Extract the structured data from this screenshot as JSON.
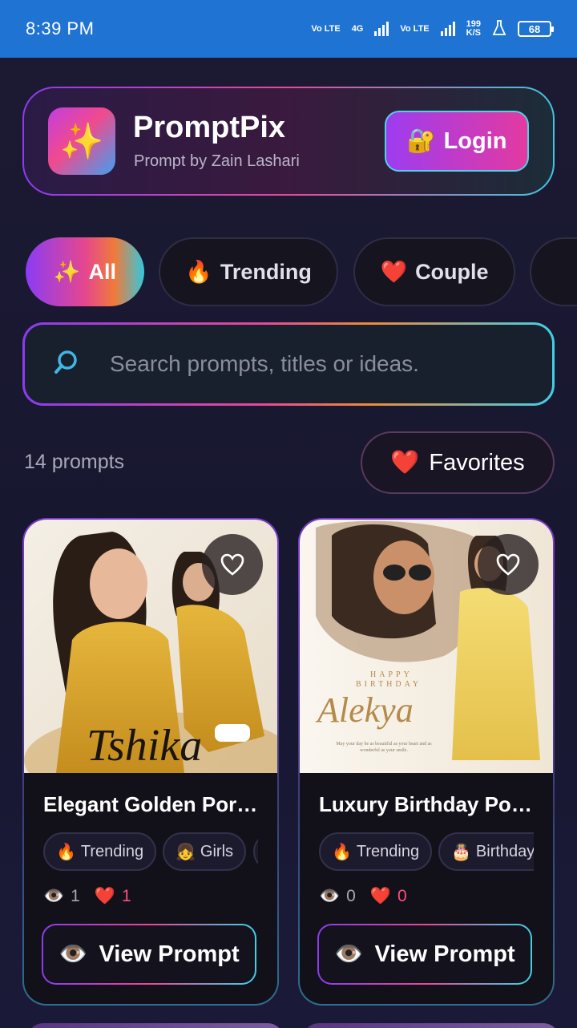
{
  "status_bar": {
    "time": "8:39 PM",
    "volte1": "Vo LTE",
    "network": "4G",
    "volte2": "Vo LTE",
    "speed_value": "199",
    "speed_unit": "K/S",
    "battery": "68"
  },
  "header": {
    "logo_icon": "sparkles-icon",
    "title": "PromptPix",
    "subtitle": "Prompt by Zain Lashari",
    "login_label": "Login",
    "login_icon": "lock-key-icon"
  },
  "categories": [
    {
      "icon": "✨",
      "label": "All",
      "active": true
    },
    {
      "icon": "🔥",
      "label": "Trending",
      "active": false
    },
    {
      "icon": "❤️",
      "label": "Couple",
      "active": false
    }
  ],
  "search": {
    "placeholder": "Search prompts, titles or ideas."
  },
  "summary": {
    "count_label": "14 prompts",
    "favorites_label": "Favorites"
  },
  "cards": [
    {
      "title": "Elegant Golden Por…",
      "tags": [
        {
          "icon": "🔥",
          "label": "Trending"
        },
        {
          "icon": "👧",
          "label": "Girls"
        }
      ],
      "views": "1",
      "likes": "1",
      "button_label": "View Prompt",
      "image_text": "Tshika"
    },
    {
      "title": "Luxury Birthday Po…",
      "tags": [
        {
          "icon": "🔥",
          "label": "Trending"
        },
        {
          "icon": "🎂",
          "label": "Birthday"
        }
      ],
      "views": "0",
      "likes": "0",
      "button_label": "View Prompt",
      "image_text": "Alekya",
      "image_sub1": "HAPPY",
      "image_sub2": "BIRTHDAY",
      "image_sub3": "May your day be as beautiful as your heart and as wonderful as your smile."
    }
  ],
  "colors": {
    "status_bar": "#1f73d3",
    "background": "#1a1930",
    "accent_purple": "#8b3bf0",
    "accent_pink": "#e8489a",
    "accent_cyan": "#3fd0e6",
    "like_red": "#ff4e7c"
  }
}
